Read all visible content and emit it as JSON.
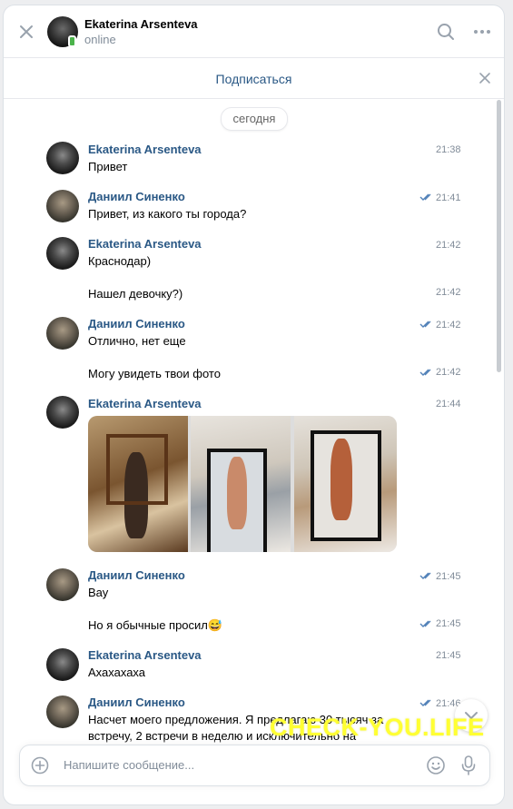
{
  "header": {
    "name": "Ekaterina Arsenteva",
    "status": "online"
  },
  "subscribe": {
    "label": "Подписаться"
  },
  "date_divider": "сегодня",
  "messages": [
    {
      "author": "Ekaterina Arsenteva",
      "text": "Привет",
      "time": "21:38",
      "read": false
    },
    {
      "author": "Даниил Синенко",
      "text": "Привет, из какого ты города?",
      "time": "21:41",
      "read": true
    },
    {
      "author": "Ekaterina Arsenteva",
      "text": "Краснодар)",
      "time": "21:42",
      "read": false
    },
    {
      "text": "Нашел девочку?)",
      "time": "21:42",
      "read": false
    },
    {
      "author": "Даниил Синенко",
      "text": "Отлично, нет еще",
      "time": "21:42",
      "read": true
    },
    {
      "text": "Могу увидеть твои фото",
      "time": "21:42",
      "read": true
    },
    {
      "author": "Ekaterina Arsenteva",
      "time": "21:44",
      "photos": 3
    },
    {
      "author": "Даниил Синенко",
      "text": "Вау",
      "time": "21:45",
      "read": true
    },
    {
      "text": "Но я обычные просил😅",
      "time": "21:45",
      "read": true
    },
    {
      "author": "Ekaterina Arsenteva",
      "text": "Ахахахаха",
      "time": "21:45",
      "read": false
    },
    {
      "author": "Даниил Синенко",
      "text": "Насчет моего предложения. Я предлагаю 30 тысяч за",
      "text2": "встречу, 2 встречи в неделю и исключительно на",
      "time": "21:46",
      "read": true
    }
  ],
  "watermark": "CHECK-YOU.LIFE",
  "composer": {
    "placeholder": "Напишите сообщение..."
  },
  "colors": {
    "accent": "#2a5885",
    "online": "#4bb34b",
    "meta": "#818c99"
  }
}
